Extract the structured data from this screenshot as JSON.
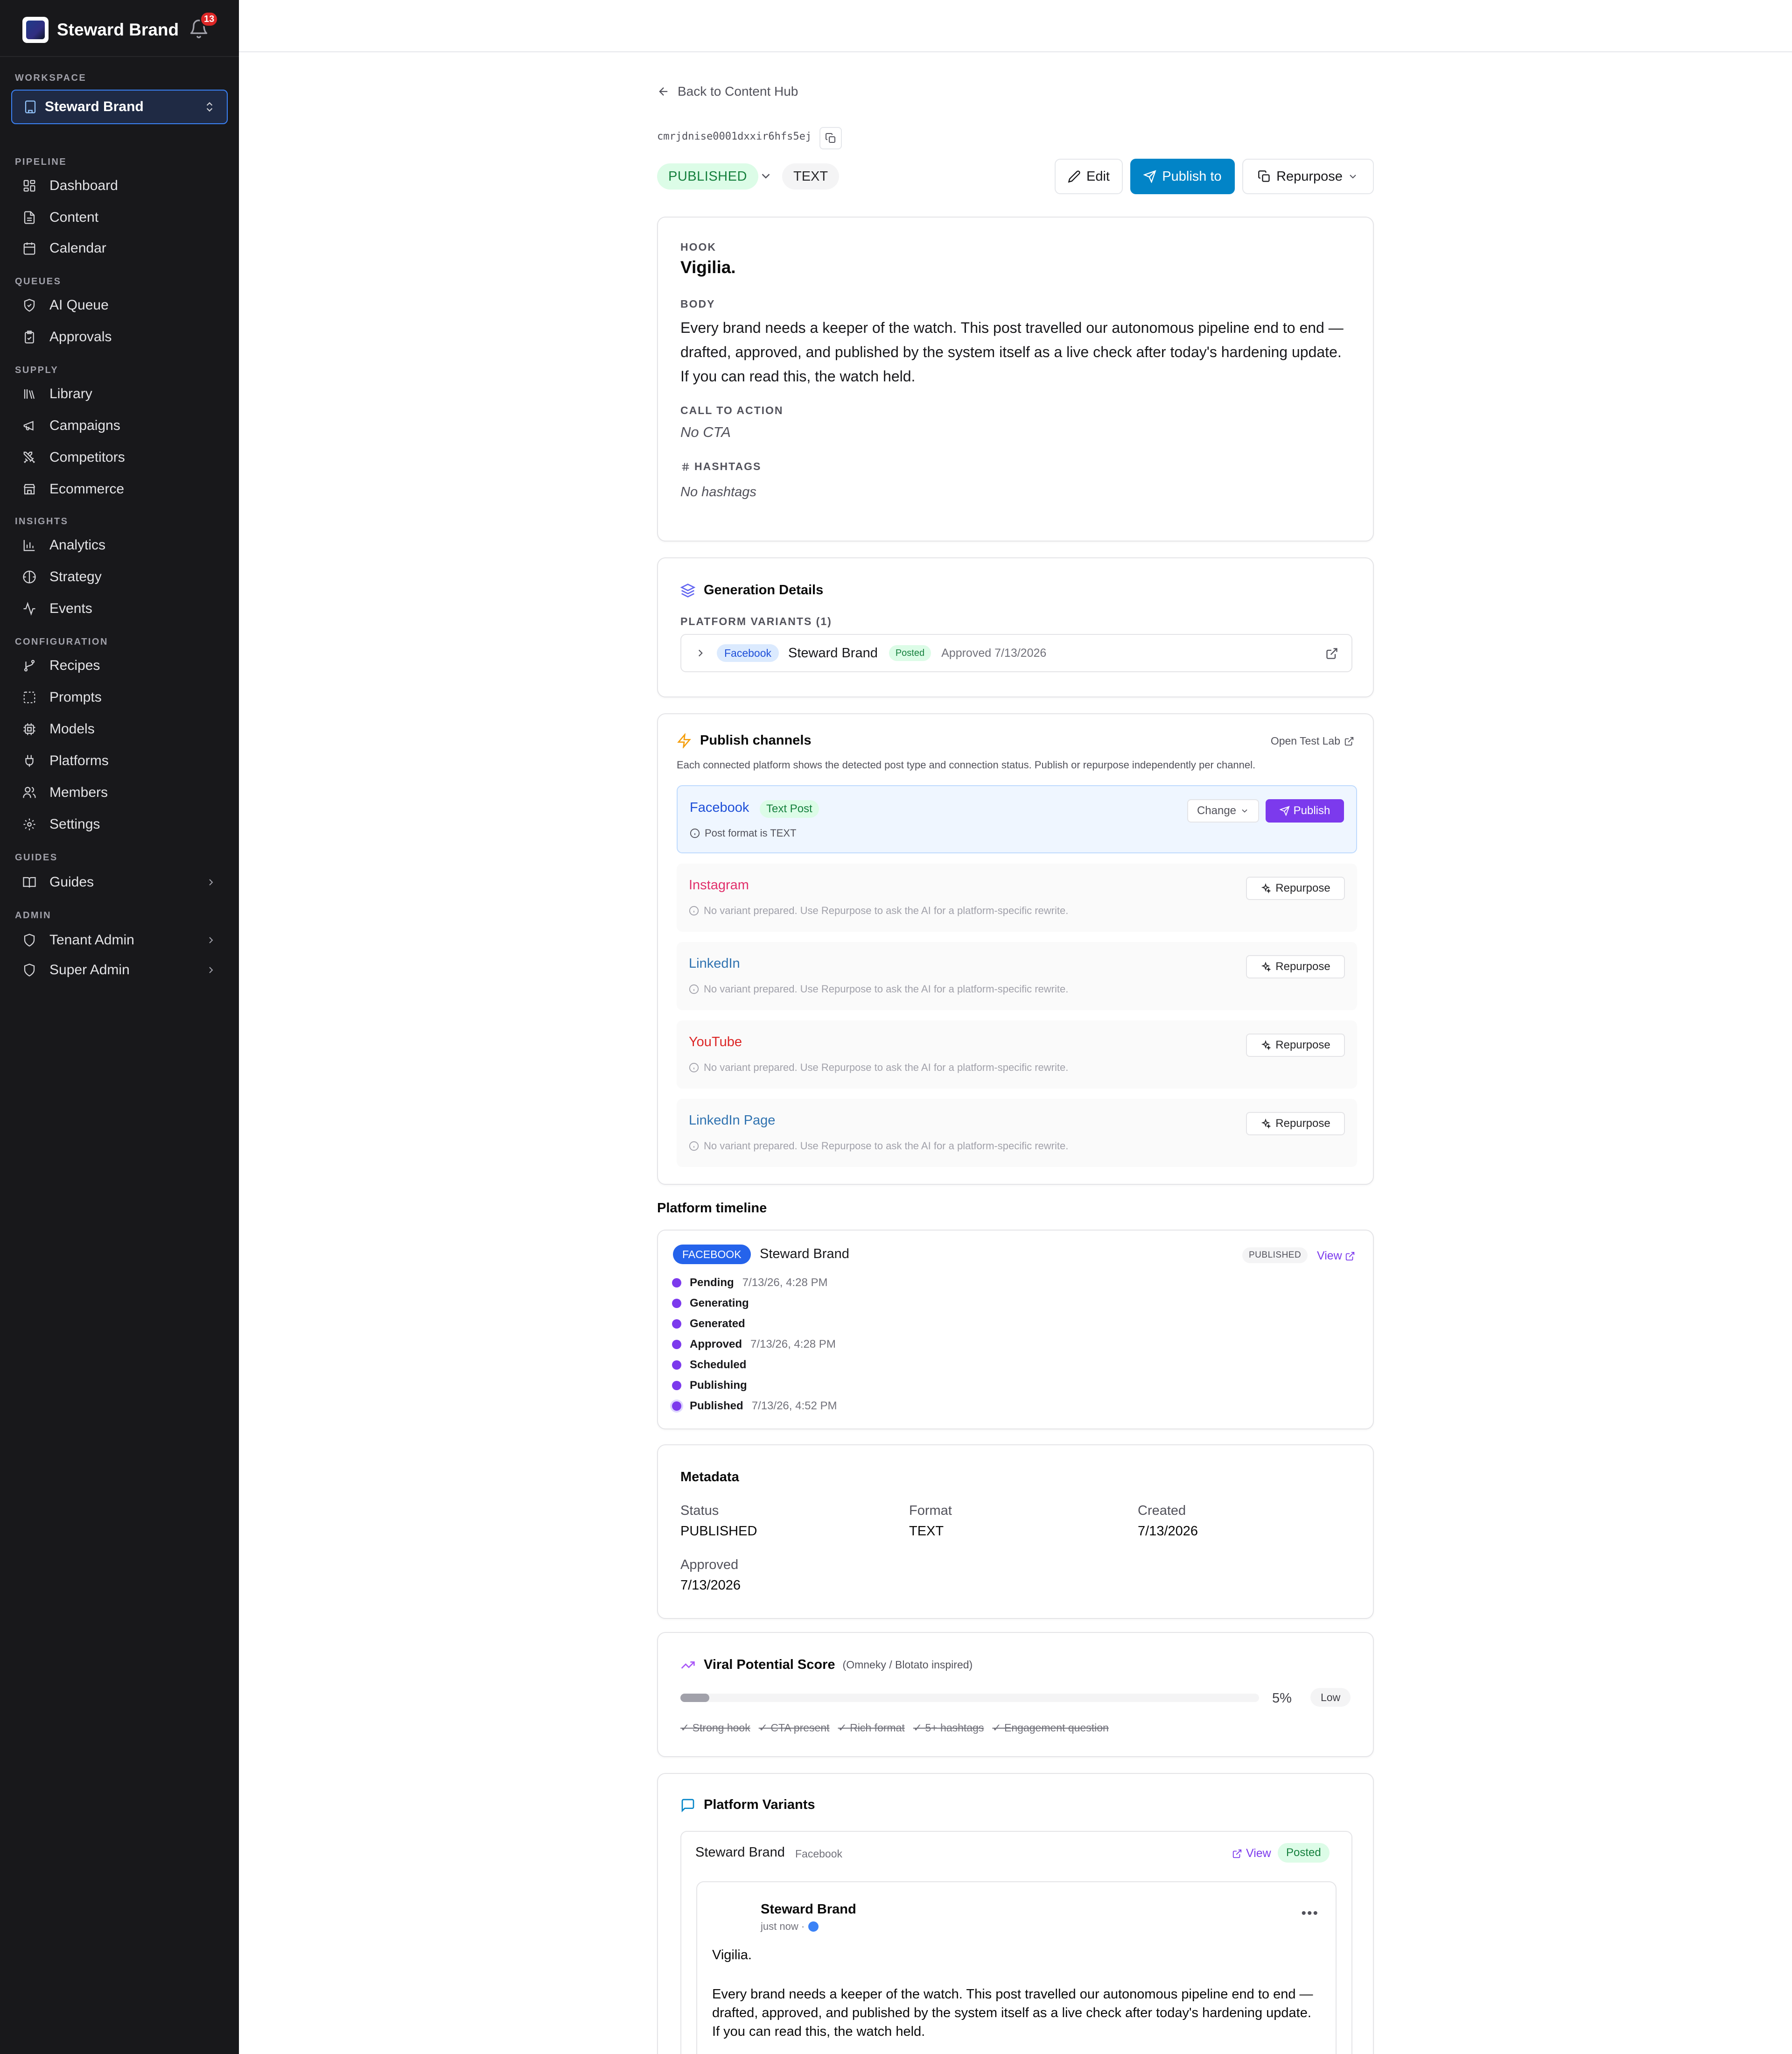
{
  "app": {
    "name": "Steward Brand",
    "notification_count": "13"
  },
  "workspace": {
    "label": "WORKSPACE",
    "selected": "Steward Brand"
  },
  "sidebar": {
    "sections": {
      "pipeline": "PIPELINE",
      "queues": "QUEUES",
      "supply": "SUPPLY",
      "insights": "INSIGHTS",
      "configuration": "CONFIGURATION",
      "guides": "GUIDES",
      "admin": "ADMIN"
    },
    "items": {
      "dashboard": "Dashboard",
      "content": "Content",
      "calendar": "Calendar",
      "ai_queue": "AI Queue",
      "approvals": "Approvals",
      "library": "Library",
      "campaigns": "Campaigns",
      "competitors": "Competitors",
      "ecommerce": "Ecommerce",
      "analytics": "Analytics",
      "strategy": "Strategy",
      "events": "Events",
      "recipes": "Recipes",
      "prompts": "Prompts",
      "models": "Models",
      "platforms": "Platforms",
      "members": "Members",
      "settings": "Settings",
      "guides": "Guides",
      "tenant_admin": "Tenant Admin",
      "super_admin": "Super Admin"
    }
  },
  "header": {
    "back_label": "Back to Content Hub",
    "content_id": "cmrjdnise0001dxxir6hfs5ej",
    "status": "PUBLISHED",
    "type": "TEXT",
    "edit_label": "Edit",
    "publish_label": "Publish to",
    "repurpose_label": "Repurpose"
  },
  "content": {
    "hook_label": "HOOK",
    "hook": "Vigilia.",
    "body_label": "BODY",
    "body": "Every brand needs a keeper of the watch. This post travelled our autonomous pipeline end to end — drafted, approved, and published by the system itself as a live check after today's hardening update. If you can read this, the watch held.",
    "cta_label": "CALL TO ACTION",
    "cta": "No CTA",
    "hashtags_label": "HASHTAGS",
    "hashtags": "No hashtags"
  },
  "generation": {
    "title": "Generation Details",
    "variants_label": "PLATFORM VARIANTS (1)",
    "variant": {
      "platform": "Facebook",
      "account": "Steward Brand",
      "status": "Posted",
      "approved": "Approved 7/13/2026"
    }
  },
  "channels": {
    "title": "Publish channels",
    "test_lab": "Open Test Lab",
    "subtitle": "Each connected platform shows the detected post type and connection status. Publish or repurpose independently per channel.",
    "facebook": {
      "name": "Facebook",
      "badge": "Text Post",
      "note": "Post format is TEXT",
      "change": "Change",
      "publish": "Publish",
      "color": "#1d4ed8"
    },
    "no_variant_note": "No variant prepared. Use Repurpose to ask the AI for a platform-specific rewrite.",
    "repurpose": "Repurpose",
    "others": [
      {
        "name": "Instagram",
        "color": "#e1306c"
      },
      {
        "name": "LinkedIn",
        "color": "#2f72b0"
      },
      {
        "name": "YouTube",
        "color": "#dc2626"
      },
      {
        "name": "LinkedIn Page",
        "color": "#2f72b0"
      }
    ]
  },
  "timeline": {
    "title": "Platform timeline",
    "platform": "FACEBOOK",
    "account": "Steward Brand",
    "status": "PUBLISHED",
    "view": "View",
    "steps": [
      {
        "label": "Pending",
        "time": "7/13/26, 4:28 PM"
      },
      {
        "label": "Generating",
        "time": ""
      },
      {
        "label": "Generated",
        "time": ""
      },
      {
        "label": "Approved",
        "time": "7/13/26, 4:28 PM"
      },
      {
        "label": "Scheduled",
        "time": ""
      },
      {
        "label": "Publishing",
        "time": ""
      },
      {
        "label": "Published",
        "time": "7/13/26, 4:52 PM"
      }
    ]
  },
  "metadata": {
    "title": "Metadata",
    "status_label": "Status",
    "status": "PUBLISHED",
    "format_label": "Format",
    "format": "TEXT",
    "created_label": "Created",
    "created": "7/13/2026",
    "approved_label": "Approved",
    "approved": "7/13/2026"
  },
  "viral": {
    "title": "Viral Potential Score",
    "note": "(Omneky / Blotato inspired)",
    "score": 0.05,
    "score_text": "5%",
    "level": "Low",
    "criteria": [
      "✓ Strong hook",
      "✓ CTA present",
      "✓ Rich format",
      "✓ 5+ hashtags",
      "✓ Engagement question"
    ]
  },
  "platform_variants": {
    "title": "Platform Variants",
    "account": "Steward Brand",
    "platform": "Facebook",
    "view": "View",
    "status": "Posted",
    "post": {
      "name": "Steward Brand",
      "meta": "just now ·",
      "hook": "Vigilia.",
      "body": "Every brand needs a keeper of the watch. This post travelled our autonomous pipeline end to end — drafted, approved, and published by the system itself as a live check after today's hardening update. If you can read this, the watch held."
    }
  }
}
